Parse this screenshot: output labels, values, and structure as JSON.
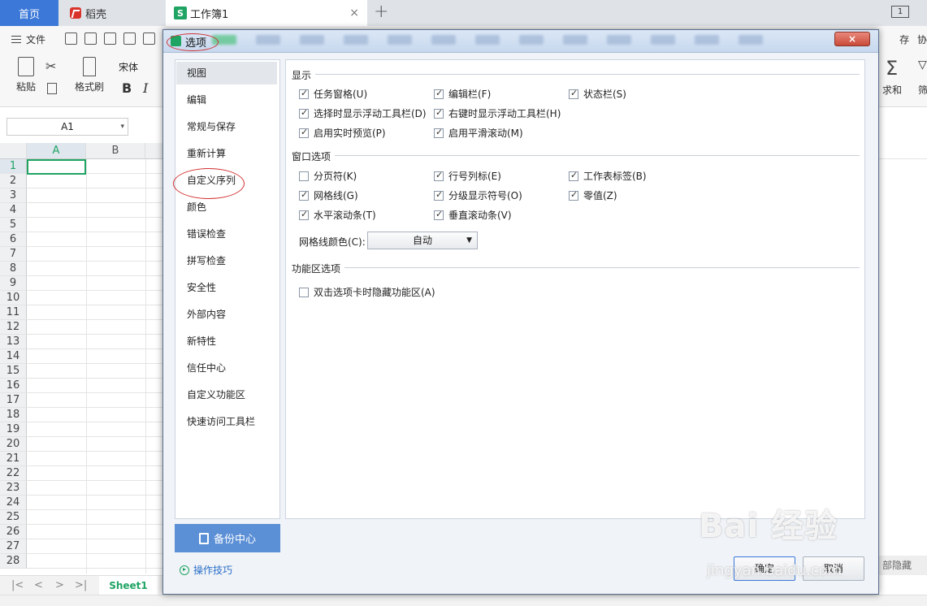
{
  "tabs": {
    "home": "首页",
    "daoke": "稻壳",
    "book": "工作簿1",
    "plus": "+",
    "close": "×",
    "window_btn": "1"
  },
  "ribbon": {
    "file": "文件",
    "right_text": "存",
    "collab": "协",
    "paste": "粘贴",
    "format_painter": "格式刷",
    "font": "宋体",
    "bold": "B",
    "italic": "I",
    "sum": "求和",
    "filter": "筛"
  },
  "namebox": "A1",
  "grid": {
    "columns": [
      "A",
      "B"
    ],
    "rows": [
      "1",
      "2",
      "3",
      "4",
      "5",
      "6",
      "7",
      "8",
      "9",
      "10",
      "11",
      "12",
      "13",
      "14",
      "15",
      "16",
      "17",
      "18",
      "19",
      "20",
      "21",
      "22",
      "23",
      "24",
      "25",
      "26",
      "27",
      "28"
    ],
    "sheet": "Sheet1",
    "right_chip": "部隐藏"
  },
  "dialog": {
    "title": "选项",
    "close": "×",
    "sidebar": [
      "视图",
      "编辑",
      "常规与保存",
      "重新计算",
      "自定义序列",
      "颜色",
      "错误检查",
      "拼写检查",
      "安全性",
      "外部内容",
      "新特性",
      "信任中心",
      "自定义功能区",
      "快速访问工具栏"
    ],
    "active_index": 0,
    "backup": "备份中心",
    "tips": "操作技巧",
    "sections": {
      "display": {
        "title": "显示",
        "items": [
          {
            "label": "任务窗格(U)",
            "checked": true
          },
          {
            "label": "编辑栏(F)",
            "checked": true
          },
          {
            "label": "状态栏(S)",
            "checked": true
          },
          {
            "label": "选择时显示浮动工具栏(D)",
            "checked": true
          },
          {
            "label": "右键时显示浮动工具栏(H)",
            "checked": true
          },
          {
            "label": "启用实时预览(P)",
            "checked": true
          },
          {
            "label": "启用平滑滚动(M)",
            "checked": true
          }
        ]
      },
      "window": {
        "title": "窗口选项",
        "items": [
          {
            "label": "分页符(K)",
            "checked": false
          },
          {
            "label": "行号列标(E)",
            "checked": true
          },
          {
            "label": "工作表标签(B)",
            "checked": true
          },
          {
            "label": "网格线(G)",
            "checked": true
          },
          {
            "label": "分级显示符号(O)",
            "checked": true
          },
          {
            "label": "零值(Z)",
            "checked": true
          },
          {
            "label": "水平滚动条(T)",
            "checked": true
          },
          {
            "label": "垂直滚动条(V)",
            "checked": true
          }
        ],
        "gridline_color_label": "网格线颜色(C):",
        "gridline_color_value": "自动"
      },
      "ribbon": {
        "title": "功能区选项",
        "items": [
          {
            "label": "双击选项卡时隐藏功能区(A)",
            "checked": false
          }
        ]
      }
    },
    "ok": "确定",
    "cancel": "取消"
  },
  "watermark": {
    "main": "Bai 经验",
    "sub": "jingyan.baidu.com"
  }
}
